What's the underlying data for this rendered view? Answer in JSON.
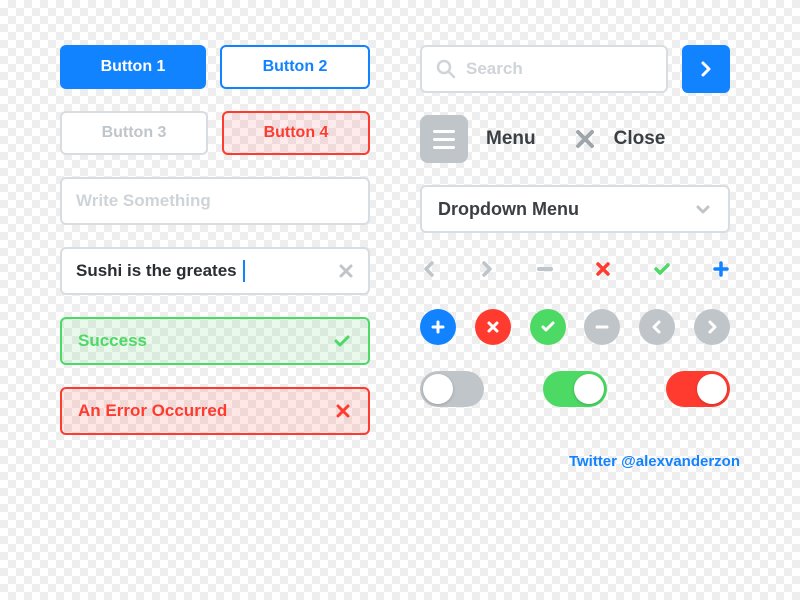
{
  "buttons": {
    "b1": "Button 1",
    "b2": "Button 2",
    "b3": "Button 3",
    "b4": "Button 4"
  },
  "inputs": {
    "write_placeholder": "Write Something",
    "text_value": "Sushi is the greates",
    "search_placeholder": "Search"
  },
  "menu": {
    "label": "Menu",
    "close": "Close"
  },
  "dropdown": {
    "label": "Dropdown Menu"
  },
  "alerts": {
    "success": "Success",
    "error": "An Error Occurred"
  },
  "colors": {
    "blue": "#1283ff",
    "red": "#ff3b30",
    "green": "#4cd964",
    "grey": "#bfc5c9"
  },
  "credit": "Twitter @alexvanderzon"
}
